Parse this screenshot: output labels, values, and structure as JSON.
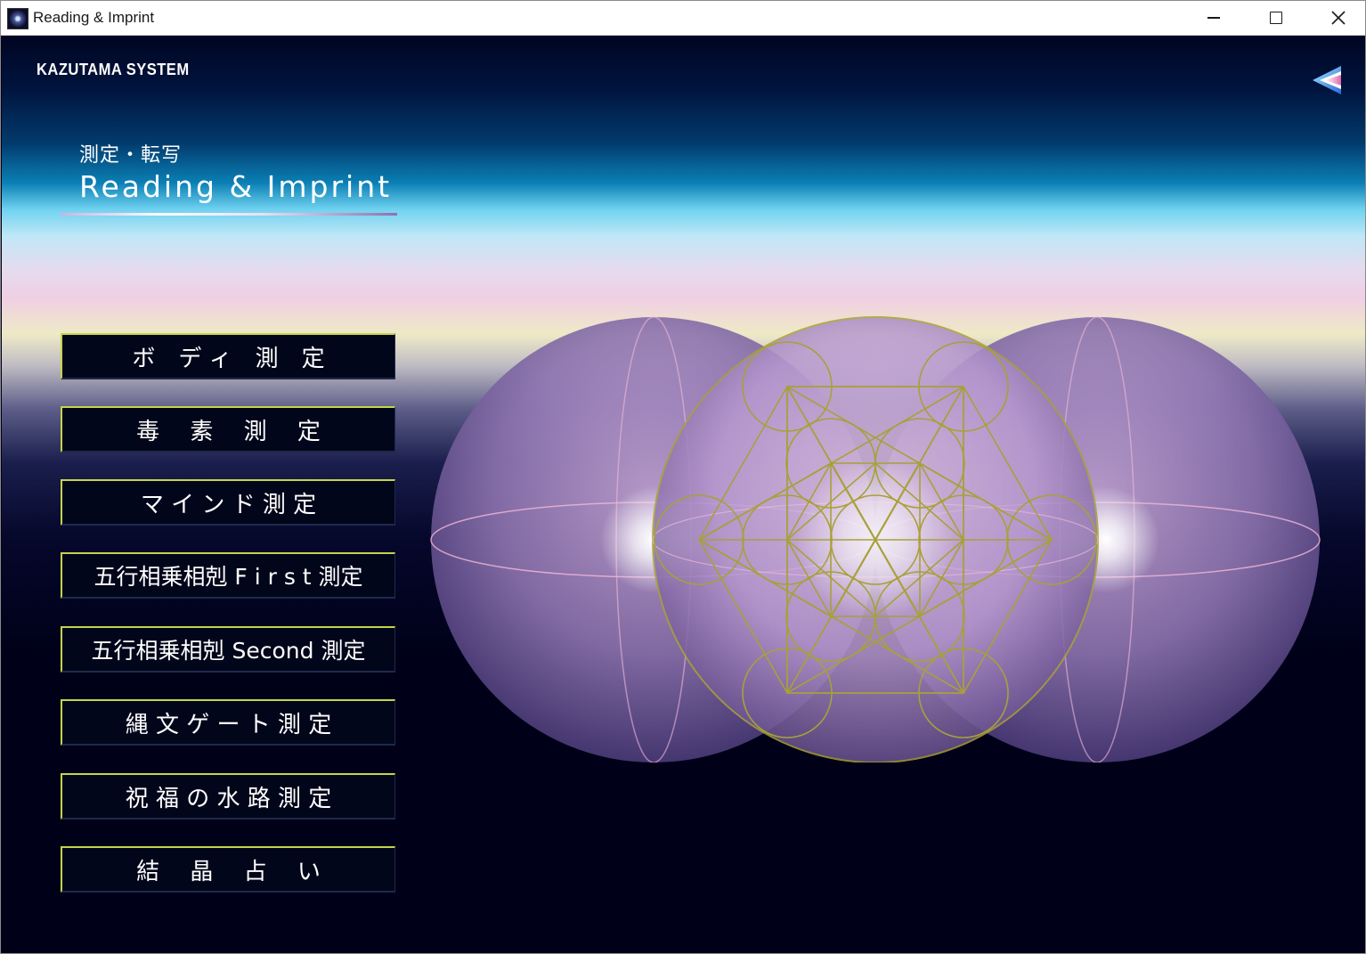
{
  "window": {
    "title": "Reading & Imprint"
  },
  "header": {
    "brand": "KAZUTAMA SYSTEM"
  },
  "heading": {
    "jp": "測定・転写",
    "en": "Reading & Imprint"
  },
  "menu": {
    "items": [
      {
        "label": "ボ　デ ィ　測　定"
      },
      {
        "label": "毒　 素　 測　 定"
      },
      {
        "label": "マ イ ン ド 測 定"
      },
      {
        "label": "五行相乗相剋 F i r s t 測定"
      },
      {
        "label": "五行相乗相剋 Second 測定"
      },
      {
        "label": "縄 文 ゲ ー ト 測 定"
      },
      {
        "label": "祝 福 の 水 路 測 定"
      },
      {
        "label": "結　 晶　 占　 い"
      }
    ]
  },
  "colors": {
    "button_accent": "#c4d44a",
    "geometry_line": "#a8a03a",
    "sphere": "#b89ad0"
  },
  "icons": {
    "back": "back-arrow-icon",
    "app": "app-icon"
  }
}
